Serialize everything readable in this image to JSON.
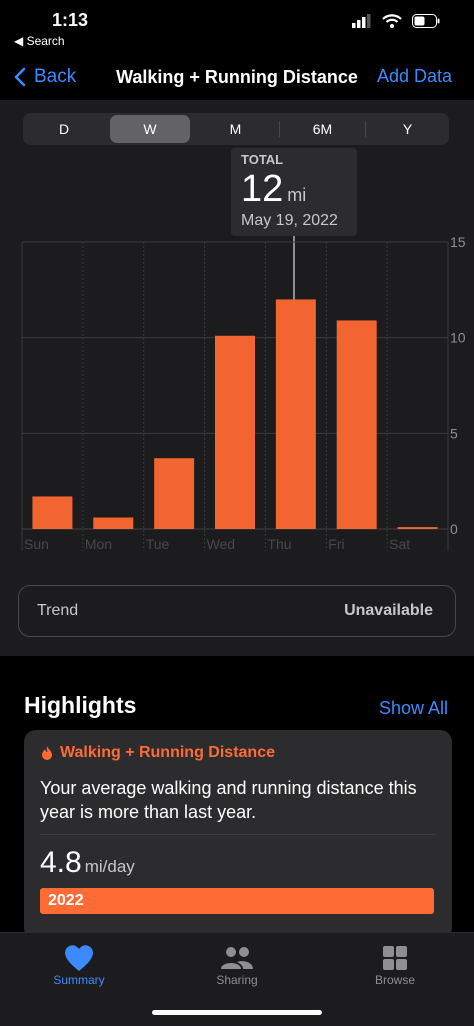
{
  "status": {
    "time": "1:13",
    "back_app": "◀ Search"
  },
  "nav": {
    "back_label": "Back",
    "title": "Walking + Running Distance",
    "action_label": "Add Data"
  },
  "segments": {
    "items": [
      "D",
      "W",
      "M",
      "6M",
      "Y"
    ],
    "selected": "W"
  },
  "tooltip": {
    "label": "TOTAL",
    "value": "12",
    "unit": "mi",
    "date": "May 19, 2022"
  },
  "chart_data": {
    "type": "bar",
    "categories": [
      "Sun",
      "Mon",
      "Tue",
      "Wed",
      "Thu",
      "Fri",
      "Sat"
    ],
    "values": [
      1.7,
      0.6,
      3.7,
      10.1,
      12.0,
      10.9,
      0.1
    ],
    "ylim": [
      0,
      15
    ],
    "yticks": [
      "15",
      "10",
      "5",
      "0"
    ],
    "grid": true,
    "highlighted": "Thu",
    "bar_color": "#f26430"
  },
  "trend": {
    "label": "Trend",
    "value": "Unavailable"
  },
  "highlights": {
    "title": "Highlights",
    "show_all": "Show All",
    "card": {
      "category": "Walking + Running Distance",
      "text": "Your average walking and running distance this year is more than last year.",
      "stat_value": "4.8",
      "stat_unit": "mi/day",
      "bar_label": "2022"
    }
  },
  "tabs": [
    {
      "label": "Summary",
      "icon": "heart-icon",
      "active": true
    },
    {
      "label": "Sharing",
      "icon": "people-icon",
      "active": false
    },
    {
      "label": "Browse",
      "icon": "grid-icon",
      "active": false
    }
  ],
  "colors": {
    "accent": "#3b8bff",
    "orange": "#ff6b35",
    "inactive": "#8e8e93"
  }
}
